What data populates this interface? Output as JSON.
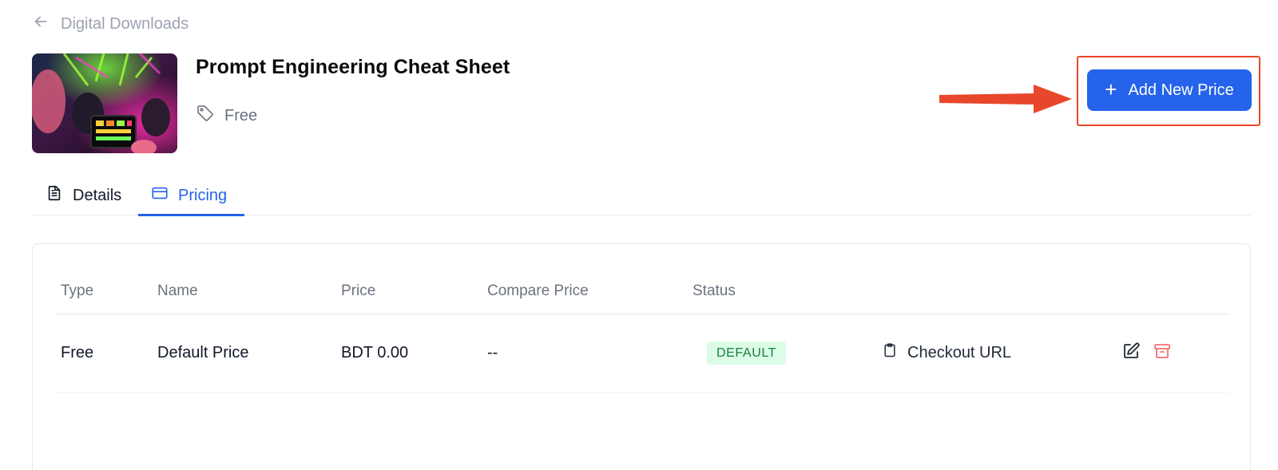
{
  "breadcrumb": {
    "label": "Digital Downloads",
    "icon": "arrow-left-icon"
  },
  "product": {
    "title": "Prompt Engineering Cheat Sheet",
    "price_label": "Free",
    "tag_icon": "tag-icon"
  },
  "actions": {
    "add_price_label": "Add New Price",
    "plus_symbol": "+"
  },
  "tabs": [
    {
      "label": "Details",
      "icon": "document-icon",
      "active": false
    },
    {
      "label": "Pricing",
      "icon": "credit-card-icon",
      "active": true
    }
  ],
  "table": {
    "headers": [
      "Type",
      "Name",
      "Price",
      "Compare Price",
      "Status"
    ],
    "rows": [
      {
        "type": "Free",
        "name": "Default Price",
        "price": "BDT 0.00",
        "compare_price": "--",
        "status": "DEFAULT",
        "checkout_label": "Checkout URL",
        "actions": [
          "edit-icon",
          "archive-icon"
        ]
      }
    ]
  },
  "colors": {
    "accent": "#2563eb",
    "annotation": "#e8472b",
    "status_default_bg": "#dcfce7",
    "status_default_text": "#15803d",
    "archive": "#f87171"
  }
}
